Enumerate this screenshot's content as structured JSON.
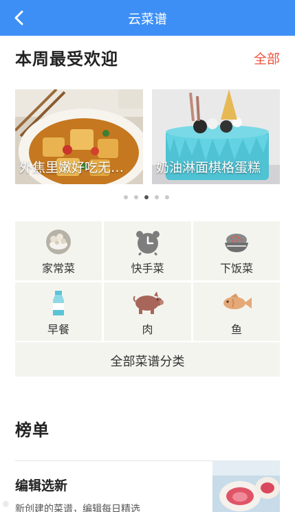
{
  "header": {
    "title": "云菜谱",
    "back_icon": "chevron-left-icon"
  },
  "weekly": {
    "title": "本周最受欢迎",
    "all_label": "全部",
    "slides": [
      {
        "caption": "外焦里嫩好吃无…"
      },
      {
        "caption": "奶油淋面棋格蛋糕"
      }
    ],
    "dots": {
      "count": 5,
      "active_index": 2
    }
  },
  "categories": {
    "items": [
      {
        "label": "家常菜",
        "icon": "home-dish-icon"
      },
      {
        "label": "快手菜",
        "icon": "alarm-clock-icon"
      },
      {
        "label": "下饭菜",
        "icon": "rice-bowl-icon"
      },
      {
        "label": "早餐",
        "icon": "milk-bottle-icon"
      },
      {
        "label": "肉",
        "icon": "pig-icon"
      },
      {
        "label": "鱼",
        "icon": "fish-icon"
      }
    ],
    "all_label": "全部菜谱分类"
  },
  "ranking": {
    "title": "榜单",
    "items": [
      {
        "title": "编辑选新",
        "subtitle": "新创建的菜谱，编辑每日精选"
      }
    ]
  },
  "colors": {
    "accent": "#3d8ff5",
    "link": "#f0523e",
    "tile": "#f4f4ef"
  }
}
